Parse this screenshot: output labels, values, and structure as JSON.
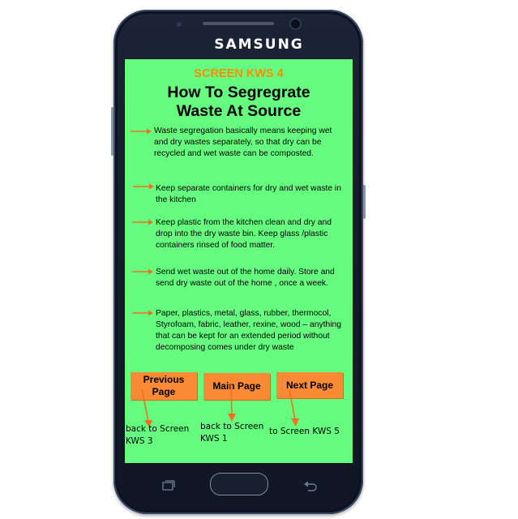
{
  "device": {
    "brand": "SAMSUNG"
  },
  "screen": {
    "id_label": "SCREEN KWS 4",
    "title_line1": "How To Segregrate",
    "title_line2": "Waste At Source",
    "bullets": [
      {
        "text": "Waste segregation basically means keeping wet and dry wastes separately, so that dry can be recycled and wet waste can be composted."
      },
      {
        "text": "Keep separate containers for dry and wet waste in the kitchen"
      },
      {
        "text": "Keep plastic from the kitchen clean and dry and drop into the dry waste bin. Keep glass /plastic containers rinsed of food matter."
      },
      {
        "text": "Send wet waste out of the home daily. Store and send dry waste out of the home , once a week."
      },
      {
        "text": "Paper, plastics, metal, glass, rubber, thermocol, Styrofoam, fabric, leather, rexine, wood – anything that can be kept for an extended period without decomposing comes under dry waste"
      }
    ],
    "buttons": {
      "previous": "Previous Page",
      "main": "Main Page",
      "next": "Next Page"
    }
  },
  "annotations": {
    "previous_note": "back to Screen KWS 3",
    "main_note": "back to Screen KWS 1",
    "next_note": "to Screen KWS 5"
  },
  "colors": {
    "screen_bg": "#66fc7f",
    "accent_orange": "#ff8c00",
    "button_bg": "#fb8a35",
    "phone_body": "#141b2a"
  },
  "icons": [
    "right-arrow-icon",
    "down-arrow-icon",
    "recent-apps-icon",
    "back-icon"
  ]
}
